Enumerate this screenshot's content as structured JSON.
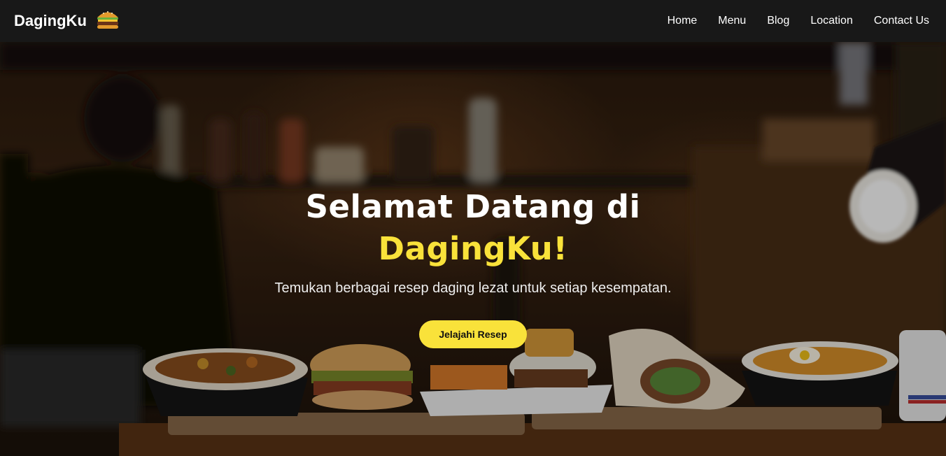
{
  "nav": {
    "brand": "DagingKu",
    "brand_icon": "burger-icon",
    "links": [
      "Home",
      "Menu",
      "Blog",
      "Location",
      "Contact Us"
    ]
  },
  "hero": {
    "title_line1": "Selamat Datang di",
    "title_line2": "DagingKu!",
    "subtitle": "Temukan berbagai resep daging lezat untuk setiap kesempatan.",
    "cta_label": "Jelajahi Resep",
    "background": "food-restaurant-photo"
  },
  "colors": {
    "accent": "#f9e23a",
    "navbar": "#181818",
    "text": "#ffffff"
  }
}
